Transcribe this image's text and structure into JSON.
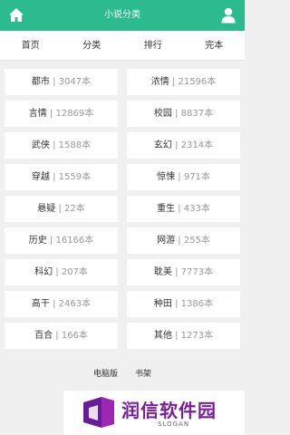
{
  "header": {
    "title": "小说分类",
    "home_icon": "home-icon",
    "user_icon": "user-icon",
    "bg_color": "#2bbb8d"
  },
  "nav": {
    "tabs": [
      {
        "label": "首页"
      },
      {
        "label": "分类"
      },
      {
        "label": "排行"
      },
      {
        "label": "完本"
      }
    ]
  },
  "categories": [
    {
      "name": "都市",
      "count": "3047本"
    },
    {
      "name": "浓情",
      "count": "21596本"
    },
    {
      "name": "言情",
      "count": "12869本"
    },
    {
      "name": "校园",
      "count": "8837本"
    },
    {
      "name": "武侠",
      "count": "1588本"
    },
    {
      "name": "玄幻",
      "count": "2314本"
    },
    {
      "name": "穿越",
      "count": "1559本"
    },
    {
      "name": "惊悚",
      "count": "971本"
    },
    {
      "name": "悬疑",
      "count": "22本"
    },
    {
      "name": "重生",
      "count": "433本"
    },
    {
      "name": "历史",
      "count": "16166本"
    },
    {
      "name": "网游",
      "count": "255本"
    },
    {
      "name": "科幻",
      "count": "207本"
    },
    {
      "name": "耽美",
      "count": "7773本"
    },
    {
      "name": "高干",
      "count": "2463本"
    },
    {
      "name": "种田",
      "count": "1386本"
    },
    {
      "name": "百合",
      "count": "166本"
    },
    {
      "name": "其他",
      "count": "1273本"
    }
  ],
  "separator": "|",
  "footer": {
    "links": [
      {
        "label": "电脑版"
      },
      {
        "label": "书架"
      }
    ]
  },
  "logo": {
    "name": "润信软件园",
    "slogan": "SLOGAN",
    "color": "#7a1f9a"
  }
}
